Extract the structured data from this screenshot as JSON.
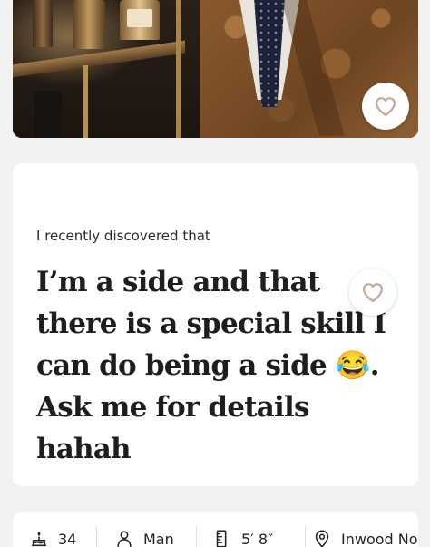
{
  "photo": {
    "description_icon": "heart-icon"
  },
  "prompt": {
    "label": "I recently discovered that",
    "answer": "I’m a side and that there is a special skill I can do being a side 😂. Ask me for details hahah"
  },
  "info": {
    "age": "34",
    "gender": "Man",
    "height": "5′ 8″",
    "location": "Inwood No"
  },
  "colors": {
    "accent": "#c9a99c",
    "card": "#ffffff",
    "background": "#f2f2f2"
  }
}
